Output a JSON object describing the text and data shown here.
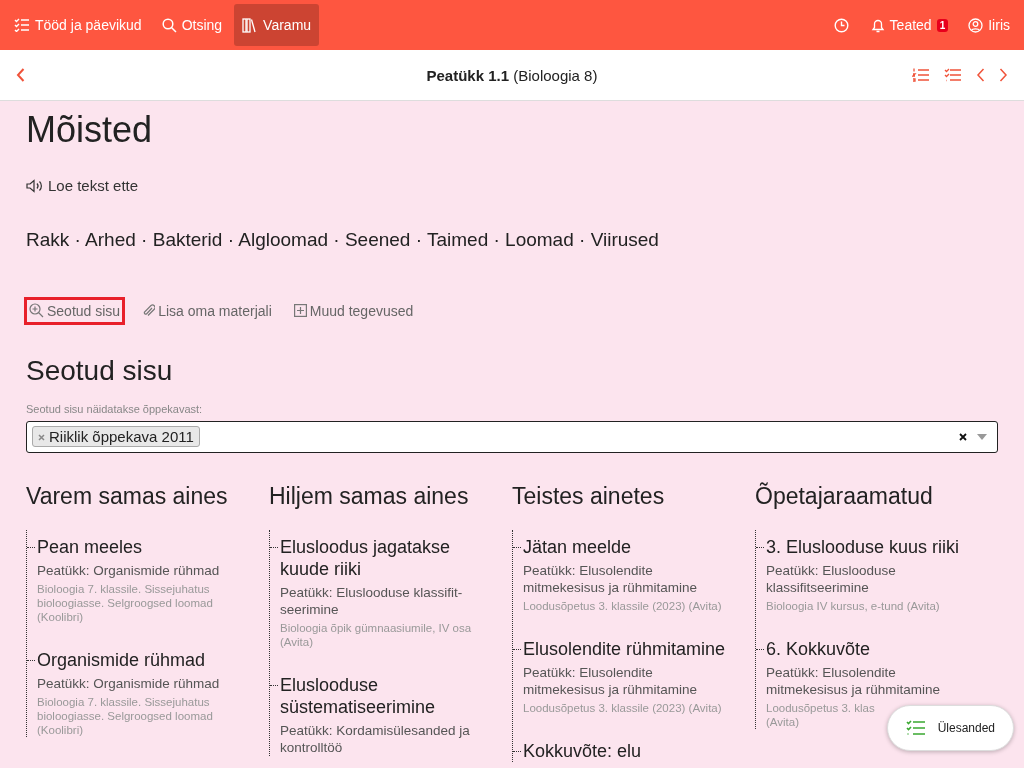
{
  "nav": {
    "left": [
      {
        "kind": "tasks",
        "label": "Tööd ja päevikud",
        "selected": false
      },
      {
        "kind": "search",
        "label": "Otsing",
        "selected": false
      },
      {
        "kind": "library",
        "label": "Varamu",
        "selected": true
      }
    ],
    "notifications": {
      "label": "Teated",
      "count": "1"
    },
    "user": {
      "label": "Iiris"
    }
  },
  "header": {
    "title_bold": "Peatükk 1.1",
    "title_rest": "(Bioloogia 8)"
  },
  "page_title": "Mõisted",
  "read_aloud": "Loe tekst ette",
  "terms": "Rakk · Arhed · Bakterid · Algloomad · Seened · Taimed · Loomad · Viirused",
  "actions": [
    {
      "kind": "zoom",
      "label": "Seotud sisu",
      "selected": true
    },
    {
      "kind": "clip",
      "label": "Lisa oma materjali",
      "selected": false
    },
    {
      "kind": "plus",
      "label": "Muud tegevused",
      "selected": false
    }
  ],
  "related": {
    "title": "Seotud sisu",
    "filter_label": "Seotud sisu näidatakse õppekavast:",
    "tags": [
      "Riiklik õppekava 2011"
    ]
  },
  "columns": [
    {
      "title": "Varem samas aines",
      "items": [
        {
          "title": "Pean meeles",
          "chapter": "Peatükk: Organismide rühmad",
          "source": "Bioloogia 7. klassile. Sissejuhatus bioloogiasse. Selgroogsed loomad (Koolibri)"
        },
        {
          "title": "Organismide rühmad",
          "chapter": "Peatükk: Organismide rühmad",
          "source": "Bioloogia 7. klassile. Sissejuhatus bioloogiasse. Selgroogsed loomad (Koolibri)"
        }
      ]
    },
    {
      "title": "Hiljem samas aines",
      "items": [
        {
          "title": "Elusloodus jagatakse kuude riiki",
          "chapter": "Peatükk: Eluslooduse klassifit-seerimine",
          "source": "Bioloogia õpik gümnaasiumile, IV osa (Avita)"
        },
        {
          "title": "Eluslooduse süstematiseerimine",
          "chapter": "Peatükk: Kordamisülesanded ja kontrolltöö"
        }
      ]
    },
    {
      "title": "Teistes ainetes",
      "items": [
        {
          "title": "Jätan meelde",
          "chapter": "Peatükk: Elusolendite mitmekesisus ja rühmitamine",
          "source": "Loodusõpetus 3. klassile (2023) (Avita)"
        },
        {
          "title": "Elusolendite rühmitamine",
          "chapter": "Peatükk: Elusolendite mitmekesisus ja rühmitamine",
          "source": "Loodusõpetus 3. klassile (2023) (Avita)"
        },
        {
          "title": "Kokkuvõte: elu"
        }
      ]
    },
    {
      "title": "Õpetajaraamatud",
      "items": [
        {
          "title": "3. Eluslooduse kuus riiki",
          "chapter": "Peatükk: Eluslooduse klassifitseerimine",
          "source": "Bioloogia IV kursus, e-tund (Avita)"
        },
        {
          "title": "6. Kokkuvõte",
          "chapter": "Peatükk: Elusolendite mitmekesisus ja rühmitamine",
          "source": [
            "Loodusõpetus 3. klas",
            "(Avita)"
          ]
        }
      ]
    }
  ],
  "fab": {
    "label": "Ülesanded"
  }
}
